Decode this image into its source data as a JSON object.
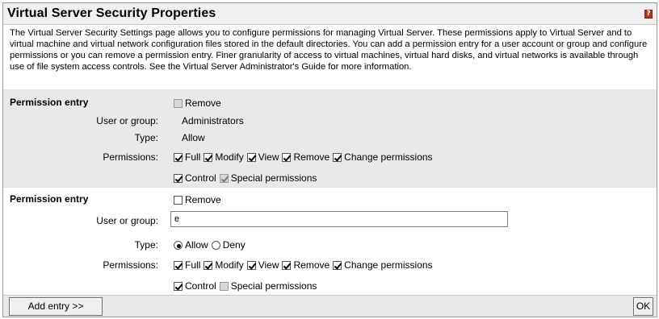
{
  "window": {
    "title": "Virtual Server Security Properties",
    "help_icon": "help-icon"
  },
  "description": "The Virtual Server Security Settings page allows you to configure permissions for managing Virtual Server. These permissions apply to Virtual Server and to virtual machine and virtual network configuration files stored in the default directories. You can add a permission entry for a user account or group and configure permissions or you can remove a permission entry. Finer granularity of access to virtual machines, virtual hard disks, and virtual networks is available through use of file system access controls. See the Virtual Server Administrator's Guide for more information.",
  "entries": [
    {
      "title": "Permission entry",
      "remove_label": "Remove",
      "user_label": "User or group:",
      "user_value": "Administrators",
      "type_label": "Type:",
      "type_value": "Allow",
      "permissions_label": "Permissions:",
      "perm_full": "Full",
      "perm_modify": "Modify",
      "perm_view": "View",
      "perm_remove": "Remove",
      "perm_change": "Change permissions",
      "perm_control": "Control",
      "perm_special": "Special permissions"
    },
    {
      "title": "Permission entry",
      "remove_label": "Remove",
      "user_label": "User or group:",
      "user_value": "е",
      "type_label": "Type:",
      "type_allow": "Allow",
      "type_deny": "Deny",
      "permissions_label": "Permissions:",
      "perm_full": "Full",
      "perm_modify": "Modify",
      "perm_view": "View",
      "perm_remove": "Remove",
      "perm_change": "Change permissions",
      "perm_control": "Control",
      "perm_special": "Special permissions"
    }
  ],
  "footer": {
    "add_entry_label": "Add entry >>",
    "ok_label": "OK"
  },
  "colors": {
    "section_bg": "#e9e9e9",
    "titlebar_bg": "#efefef",
    "help_icon": "#b13a22"
  }
}
